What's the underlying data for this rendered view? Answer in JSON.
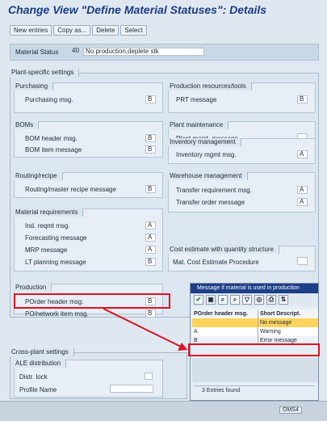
{
  "title": "Change View \"Define Material Statuses\": Details",
  "toolbar": {
    "new": "New entries",
    "copy": "Copy as...",
    "delete": "Delete",
    "select": "Select"
  },
  "status": {
    "label": "Material Status",
    "code": "40",
    "desc": "No production,deplete stk"
  },
  "plant": {
    "section": "Plant-specific settings",
    "purchasing": {
      "title": "Purchasing",
      "label": "Purchasing msg.",
      "value": "B"
    },
    "prt": {
      "title": "Production resources/tools",
      "label": "PRT message",
      "value": "B"
    },
    "boms": {
      "title": "BOMs",
      "header_label": "BOM header msg.",
      "header_value": "B",
      "item_label": "BOM item message",
      "item_value": "B"
    },
    "maint": {
      "title": "Plant maintenance",
      "label": "Plant maint. message",
      "value": ""
    },
    "inv": {
      "title": "Inventory management",
      "label": "Inventory mgmt msg.",
      "value": "A"
    },
    "routing": {
      "title": "Routing/recipe",
      "label": "Routing/master recipe message",
      "value": "B"
    },
    "wm": {
      "title": "Warehouse management",
      "tr_label": "Transfer requirement msg.",
      "tr_value": "A",
      "to_label": "Transfer order message",
      "to_value": "A"
    },
    "mrp": {
      "title": "Material requirements",
      "ind_label": "Ind. reqmt msg.",
      "ind_value": "A",
      "fc_label": "Forecasting message",
      "fc_value": "A",
      "mrp_label": "MRP message",
      "mrp_value": "A",
      "lt_label": "LT planning message",
      "lt_value": "B"
    },
    "cost": {
      "title": "Cost estimate with quantity structure",
      "label": "Mat. Cost Estimate Procedure",
      "value": ""
    },
    "prod": {
      "title": "Production",
      "po_label": "POrder header msg.",
      "po_value": "B",
      "net_label": "PO/network item msg.",
      "net_value": "B"
    }
  },
  "cross": {
    "section": "Cross-plant settings",
    "ale": "ALE distribution",
    "lock": "Distr. lock",
    "profile": "Profile Name"
  },
  "popup": {
    "title": "Message if material is used in production",
    "col1": "POrder header msg.",
    "col2": "Short Descript.",
    "rows": [
      {
        "code": "",
        "desc": "No message"
      },
      {
        "code": "A",
        "desc": "Warning"
      },
      {
        "code": "B",
        "desc": "Error message"
      }
    ],
    "footer": "3 Entries found"
  },
  "bottom": {
    "tcode": "OMS4"
  },
  "colors": {
    "highlight": "#e01020",
    "selected": "#ffd35c",
    "title": "#1b3b82"
  }
}
